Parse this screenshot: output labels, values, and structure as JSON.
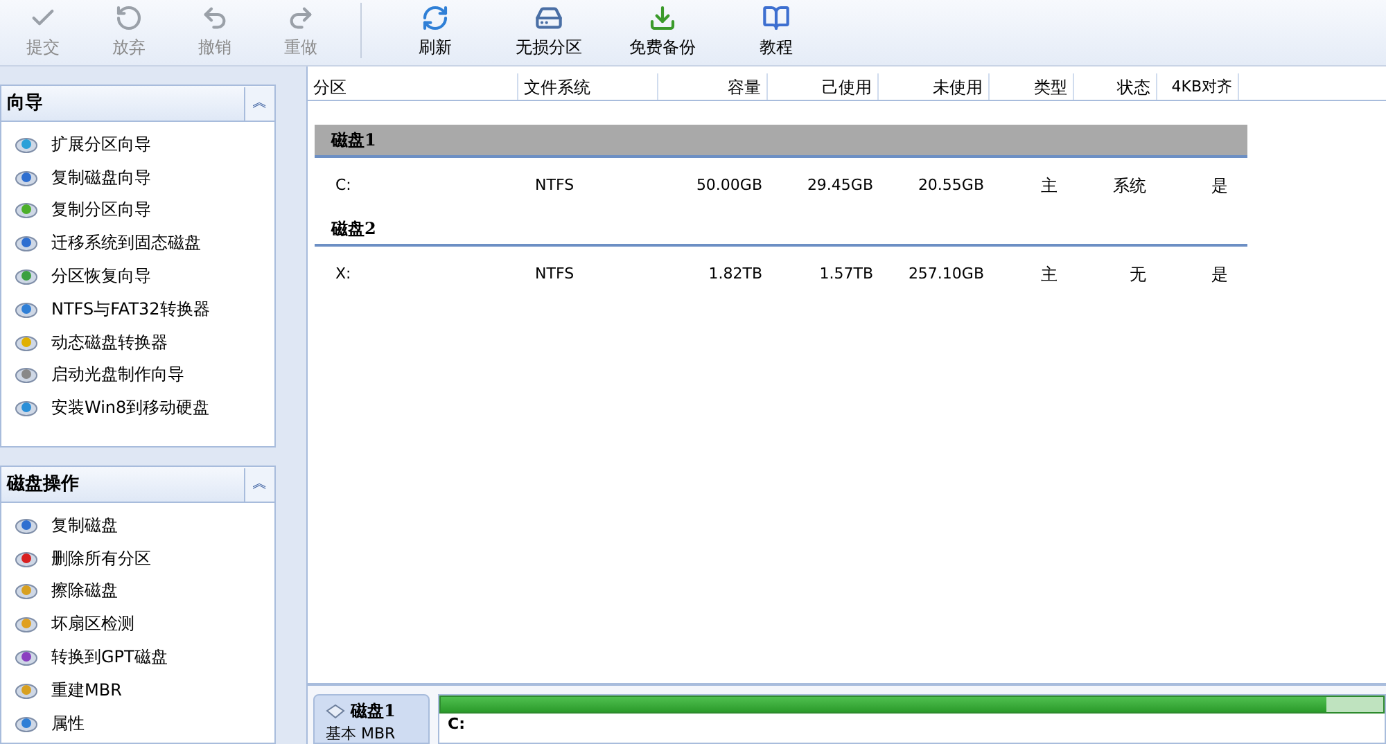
{
  "toolbar": [
    {
      "label": "提交",
      "kind": "check",
      "disabled": true
    },
    {
      "label": "放弃",
      "kind": "discard",
      "disabled": true
    },
    {
      "label": "撤销",
      "kind": "undo",
      "disabled": true
    },
    {
      "label": "重做",
      "kind": "redo",
      "disabled": true
    },
    {
      "label": "刷新",
      "kind": "refresh",
      "disabled": false
    },
    {
      "label": "无损分区",
      "kind": "partition",
      "disabled": false
    },
    {
      "label": "免费备份",
      "kind": "backup",
      "disabled": false
    },
    {
      "label": "教程",
      "kind": "book",
      "disabled": false
    }
  ],
  "sidebar": [
    {
      "title": "向导",
      "collapse": "︽",
      "items": [
        "扩展分区向导",
        "复制磁盘向导",
        "复制分区向导",
        "迁移系统到固态磁盘",
        "分区恢复向导",
        "NTFS与FAT32转换器",
        "动态磁盘转换器",
        "启动光盘制作向导",
        "安装Win8到移动硬盘"
      ]
    },
    {
      "title": "磁盘操作",
      "collapse": "︽",
      "items": [
        "复制磁盘",
        "删除所有分区",
        "擦除磁盘",
        "坏扇区检测",
        "转换到GPT磁盘",
        "重建MBR",
        "属性"
      ]
    }
  ],
  "table": {
    "columns": [
      "分区",
      "文件系统",
      "容量",
      "己使用",
      "未使用",
      "类型",
      "状态",
      "4KB对齐"
    ],
    "groups": [
      {
        "title": "磁盘1",
        "shaded": true,
        "rows": [
          [
            "C:",
            "NTFS",
            "50.00GB",
            "29.45GB",
            "20.55GB",
            "主",
            "系统",
            "是"
          ]
        ]
      },
      {
        "title": "磁盘2",
        "shaded": false,
        "rows": [
          [
            "X:",
            "NTFS",
            "1.82TB",
            "1.57TB",
            "257.10GB",
            "主",
            "无",
            "是"
          ]
        ]
      }
    ]
  },
  "disk_map": {
    "title": "磁盘1",
    "subtitle": "基本 MBR",
    "partition": "C:",
    "level": 0.94
  }
}
